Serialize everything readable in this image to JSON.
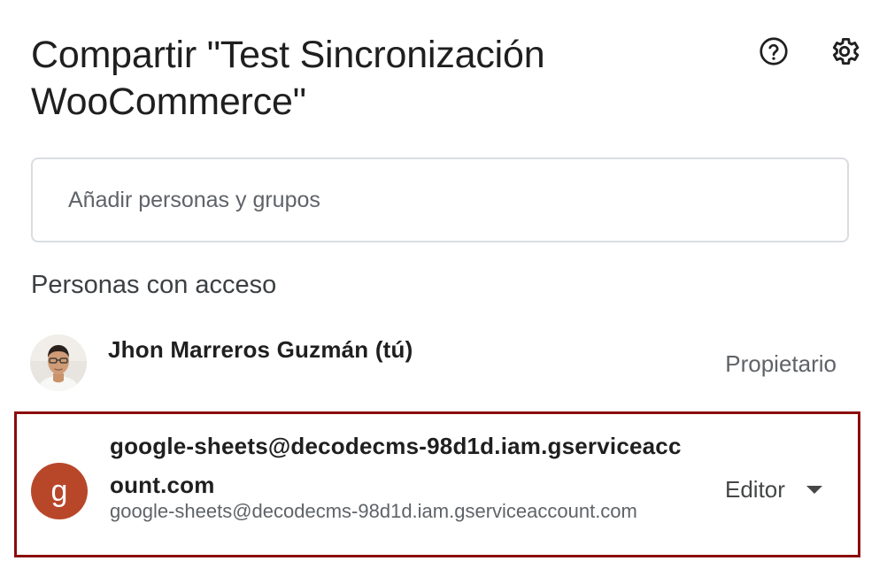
{
  "dialog": {
    "title": "Compartir \"Test Sincronización WooCommerce\""
  },
  "header_icons": {
    "help": "help-icon",
    "settings": "gear-icon"
  },
  "add_people": {
    "placeholder": "Añadir personas y grupos",
    "value": ""
  },
  "access": {
    "section_label": "Personas con acceso",
    "people": [
      {
        "name": "Jhon Marreros Guzmán (tú)",
        "email": "",
        "role": "Propietario",
        "avatar": "profile-photo"
      },
      {
        "name": "google-sheets@decodecms-98d1d.iam.gserviceaccount.com",
        "email": "google-sheets@decodecms-98d1d.iam.gserviceaccount.com",
        "role": "Editor",
        "avatar_letter": "g",
        "avatar_color": "#b8472a"
      }
    ]
  },
  "highlight_color": "#8b0b0b"
}
